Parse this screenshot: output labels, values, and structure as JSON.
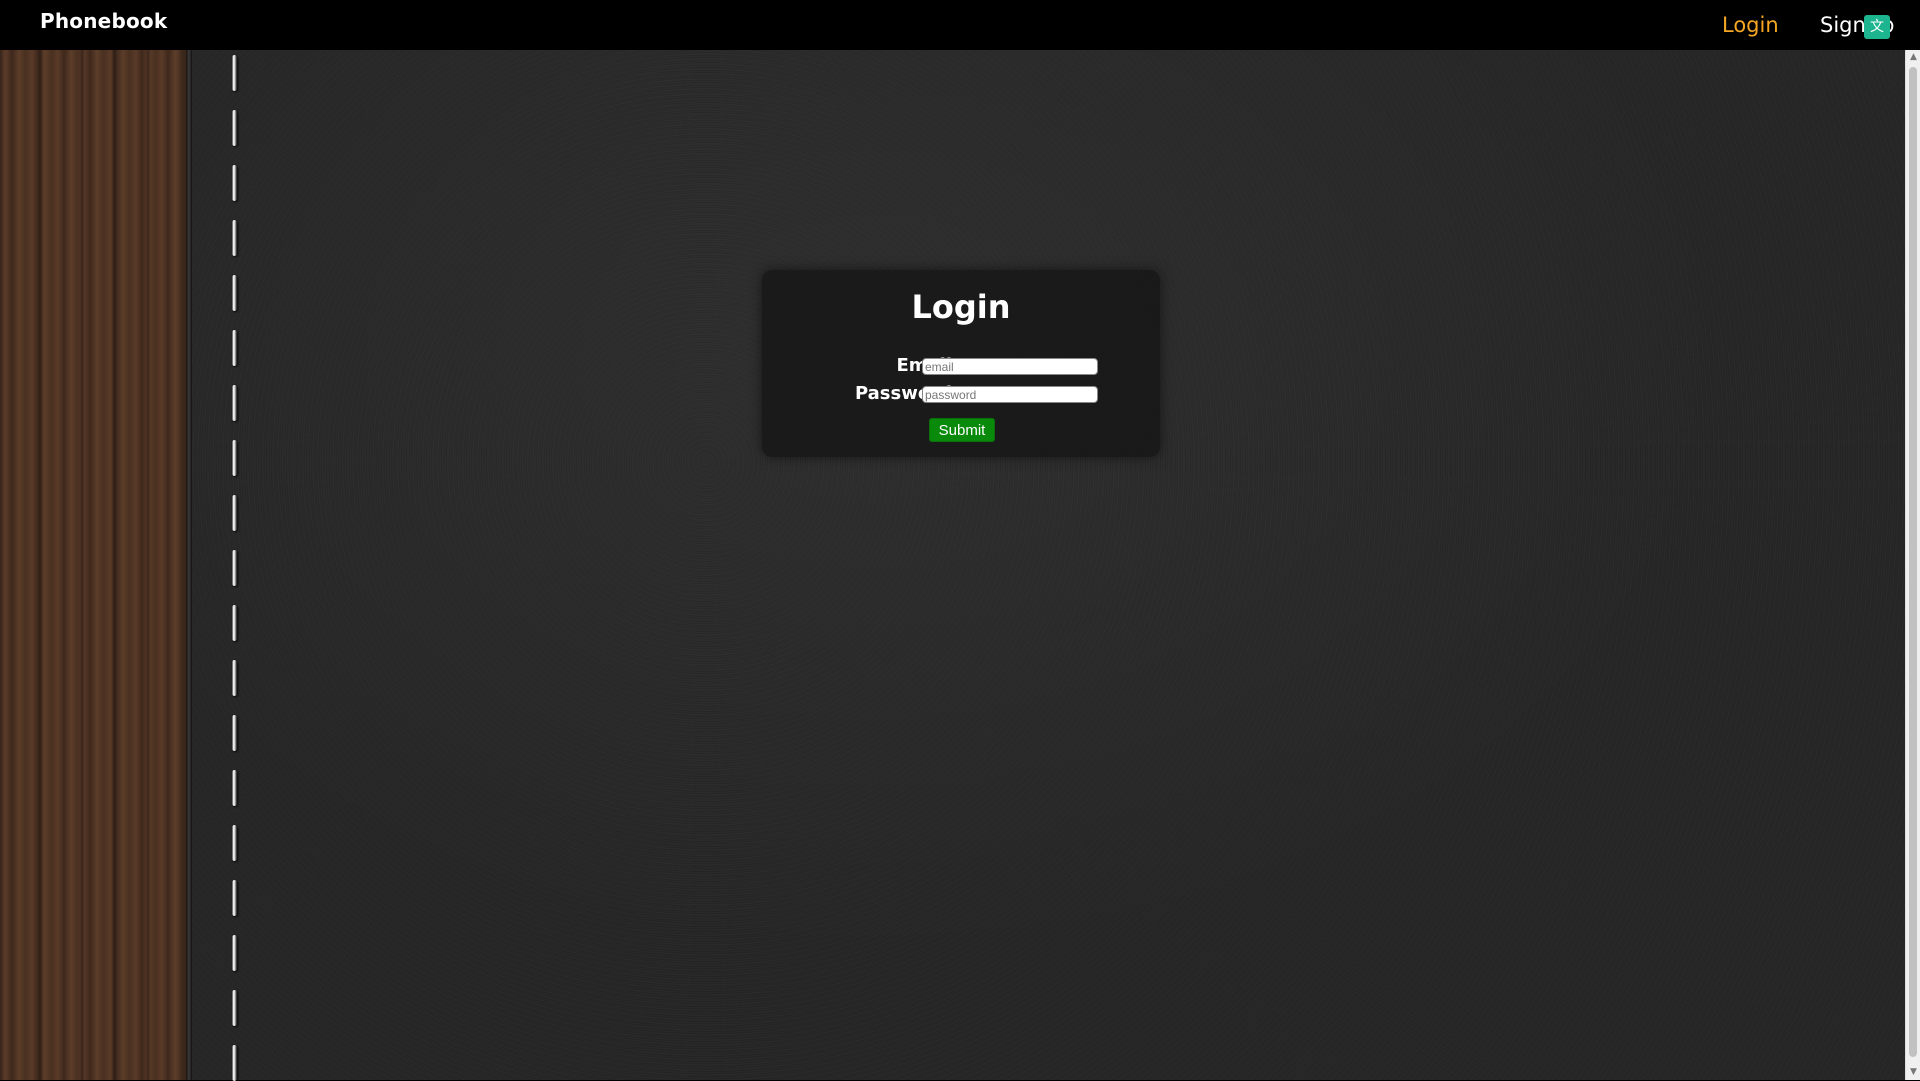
{
  "header": {
    "brand": "Phonebook",
    "nav": {
      "login_label": "Login",
      "signup_label": "SignUp"
    },
    "overlay_icon": "translate-icon"
  },
  "login_form": {
    "title": "Login",
    "email_label": "Email",
    "email_placeholder": "email",
    "email_value": "",
    "password_label": "Password",
    "password_placeholder": "password",
    "password_value": "",
    "submit_label": "Submit"
  },
  "colors": {
    "active_nav": "#f5a623",
    "submit_bg": "#0a8a0a",
    "topbar_bg": "#000000",
    "overlay_icon_bg": "#1db58f"
  }
}
